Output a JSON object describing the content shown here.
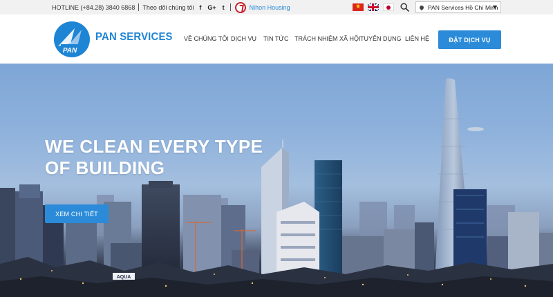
{
  "topbar": {
    "hotline": "HOTLINE (+84.28) 3840 6868",
    "follow_label": "Theo dõi chúng tôi",
    "social": [
      "f",
      "G+",
      "t"
    ],
    "partner": "Nihon Housing",
    "languages": [
      "vietnam-flag-icon",
      "uk-flag-icon",
      "japan-flag-icon"
    ],
    "location": "PAN Services Hồ Chí Minh"
  },
  "header": {
    "brand": "PAN SERVICES",
    "logo_text": "PAN",
    "nav": [
      "VỀ CHÚNG TÔI",
      "DỊCH VỤ",
      "TIN TỨC",
      "TRÁCH NHIỆM XÃ HỘI",
      "TUYỂN DỤNG",
      "LIÊN HỆ"
    ],
    "cta": "ĐẶT DỊCH VỤ"
  },
  "hero": {
    "title_line1": "WE CLEAN EVERY TYPE",
    "title_line2": "OF BUILDING",
    "button": "XEM CHI TIẾT",
    "sign_text": "AQUA"
  },
  "colors": {
    "accent": "#2b8bd9",
    "brand": "#1e84d4",
    "topbar_bg": "#f1f1f1",
    "nihon_red": "#c8202d"
  }
}
